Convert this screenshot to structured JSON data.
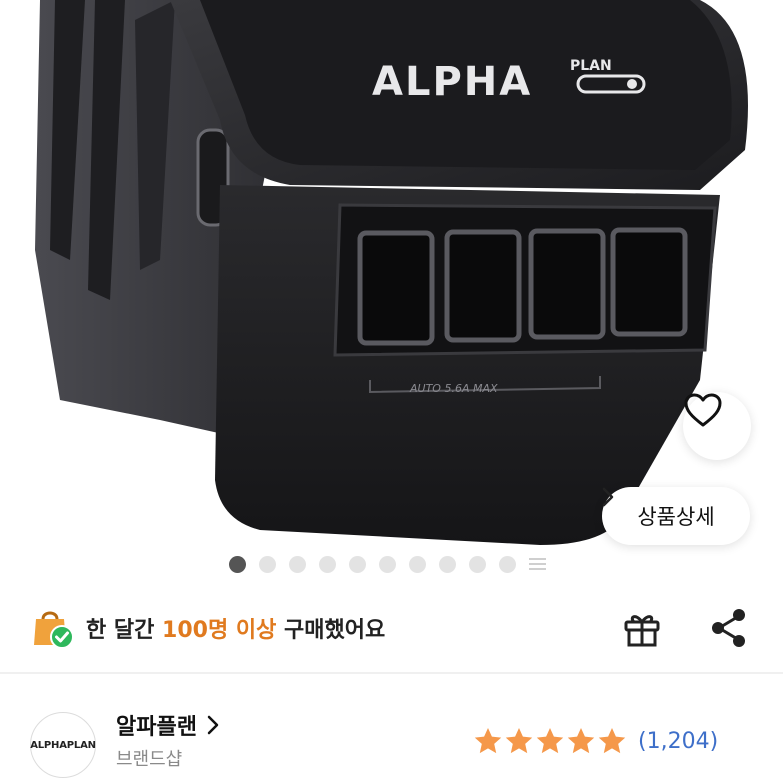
{
  "product_image": {
    "brand_text": "ALPHA",
    "brand_sub": "PLAN",
    "usb_label": "AUTO 5.6A MAX",
    "slide_count": 10,
    "active_slide": 1
  },
  "actions": {
    "like_icon": "heart-icon",
    "detail_label": "상품상세"
  },
  "purchase_banner": {
    "prefix": "한 달간 ",
    "highlight": "100명 이상",
    "suffix": " 구매했어요",
    "accent_color": "#e07a1f"
  },
  "brand": {
    "logo_text": "ALPHAPLAN",
    "name": "알파플랜",
    "type": "브랜드샵"
  },
  "rating": {
    "stars": 5,
    "count": "(1,204)",
    "star_color": "#f5984a"
  }
}
